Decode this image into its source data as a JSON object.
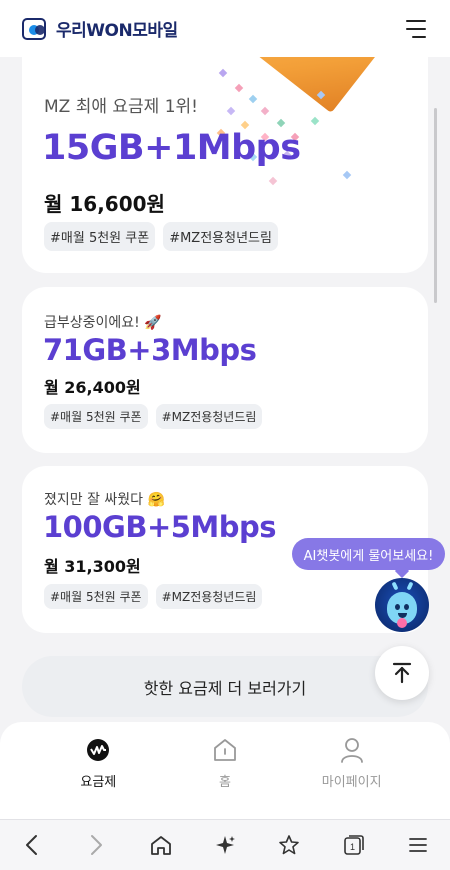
{
  "header": {
    "logo_prefix": "우리",
    "logo_won": "WON",
    "logo_suffix": "모바일"
  },
  "cards": [
    {
      "subtitle": "MZ 최애 요금제 1위!",
      "plan": "15GB+1Mbps",
      "price": "월 16,600원",
      "tags": [
        "#매월 5천원 쿠폰",
        "#MZ전용청년드림"
      ]
    },
    {
      "subtitle": "급부상중이에요!",
      "subtitle_emoji": "🚀",
      "plan": "71GB+3Mbps",
      "price": "월 26,400원",
      "tags": [
        "#매월 5천원 쿠폰",
        "#MZ전용청년드림"
      ]
    },
    {
      "subtitle": "졌지만 잘 싸웠다",
      "subtitle_emoji": "🤗",
      "plan": "100GB+5Mbps",
      "price": "월 31,300원",
      "tags": [
        "#매월 5천원 쿠폰",
        "#MZ전용청년드림"
      ]
    }
  ],
  "more_button": "핫한 요금제 더 보러가기",
  "chatbot": {
    "bubble": "AI챗봇에게 물어보세요!"
  },
  "bottom_nav": [
    {
      "label": "요금제",
      "icon": "plan-icon",
      "active": true
    },
    {
      "label": "홈",
      "icon": "home-icon",
      "active": false
    },
    {
      "label": "마이페이지",
      "icon": "user-icon",
      "active": false
    }
  ],
  "browser_bar": {
    "tab_count": "1",
    "icons": [
      "back-icon",
      "forward-icon",
      "home-icon",
      "sparkle-icon",
      "favorites-icon",
      "tabs-icon",
      "menu-icon"
    ]
  },
  "colors": {
    "accent": "#5b3fd1",
    "brand": "#1b2a6b",
    "bubble": "#8778e6",
    "background": "#f3f3f5"
  }
}
